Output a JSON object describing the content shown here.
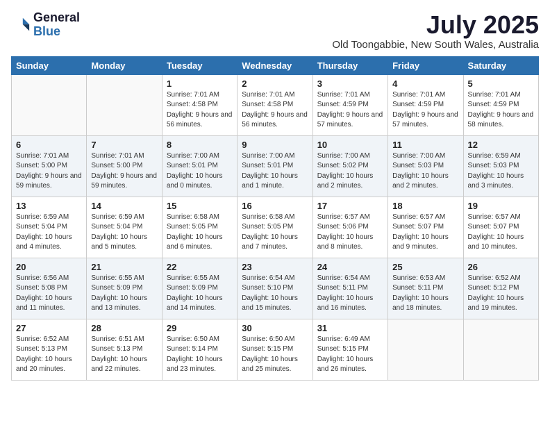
{
  "logo": {
    "general": "General",
    "blue": "Blue"
  },
  "title": {
    "month_year": "July 2025",
    "location": "Old Toongabbie, New South Wales, Australia"
  },
  "weekdays": [
    "Sunday",
    "Monday",
    "Tuesday",
    "Wednesday",
    "Thursday",
    "Friday",
    "Saturday"
  ],
  "weeks": [
    [
      {
        "day": "",
        "info": ""
      },
      {
        "day": "",
        "info": ""
      },
      {
        "day": "1",
        "info": "Sunrise: 7:01 AM\nSunset: 4:58 PM\nDaylight: 9 hours and 56 minutes."
      },
      {
        "day": "2",
        "info": "Sunrise: 7:01 AM\nSunset: 4:58 PM\nDaylight: 9 hours and 56 minutes."
      },
      {
        "day": "3",
        "info": "Sunrise: 7:01 AM\nSunset: 4:59 PM\nDaylight: 9 hours and 57 minutes."
      },
      {
        "day": "4",
        "info": "Sunrise: 7:01 AM\nSunset: 4:59 PM\nDaylight: 9 hours and 57 minutes."
      },
      {
        "day": "5",
        "info": "Sunrise: 7:01 AM\nSunset: 4:59 PM\nDaylight: 9 hours and 58 minutes."
      }
    ],
    [
      {
        "day": "6",
        "info": "Sunrise: 7:01 AM\nSunset: 5:00 PM\nDaylight: 9 hours and 59 minutes."
      },
      {
        "day": "7",
        "info": "Sunrise: 7:01 AM\nSunset: 5:00 PM\nDaylight: 9 hours and 59 minutes."
      },
      {
        "day": "8",
        "info": "Sunrise: 7:00 AM\nSunset: 5:01 PM\nDaylight: 10 hours and 0 minutes."
      },
      {
        "day": "9",
        "info": "Sunrise: 7:00 AM\nSunset: 5:01 PM\nDaylight: 10 hours and 1 minute."
      },
      {
        "day": "10",
        "info": "Sunrise: 7:00 AM\nSunset: 5:02 PM\nDaylight: 10 hours and 2 minutes."
      },
      {
        "day": "11",
        "info": "Sunrise: 7:00 AM\nSunset: 5:03 PM\nDaylight: 10 hours and 2 minutes."
      },
      {
        "day": "12",
        "info": "Sunrise: 6:59 AM\nSunset: 5:03 PM\nDaylight: 10 hours and 3 minutes."
      }
    ],
    [
      {
        "day": "13",
        "info": "Sunrise: 6:59 AM\nSunset: 5:04 PM\nDaylight: 10 hours and 4 minutes."
      },
      {
        "day": "14",
        "info": "Sunrise: 6:59 AM\nSunset: 5:04 PM\nDaylight: 10 hours and 5 minutes."
      },
      {
        "day": "15",
        "info": "Sunrise: 6:58 AM\nSunset: 5:05 PM\nDaylight: 10 hours and 6 minutes."
      },
      {
        "day": "16",
        "info": "Sunrise: 6:58 AM\nSunset: 5:05 PM\nDaylight: 10 hours and 7 minutes."
      },
      {
        "day": "17",
        "info": "Sunrise: 6:57 AM\nSunset: 5:06 PM\nDaylight: 10 hours and 8 minutes."
      },
      {
        "day": "18",
        "info": "Sunrise: 6:57 AM\nSunset: 5:07 PM\nDaylight: 10 hours and 9 minutes."
      },
      {
        "day": "19",
        "info": "Sunrise: 6:57 AM\nSunset: 5:07 PM\nDaylight: 10 hours and 10 minutes."
      }
    ],
    [
      {
        "day": "20",
        "info": "Sunrise: 6:56 AM\nSunset: 5:08 PM\nDaylight: 10 hours and 11 minutes."
      },
      {
        "day": "21",
        "info": "Sunrise: 6:55 AM\nSunset: 5:09 PM\nDaylight: 10 hours and 13 minutes."
      },
      {
        "day": "22",
        "info": "Sunrise: 6:55 AM\nSunset: 5:09 PM\nDaylight: 10 hours and 14 minutes."
      },
      {
        "day": "23",
        "info": "Sunrise: 6:54 AM\nSunset: 5:10 PM\nDaylight: 10 hours and 15 minutes."
      },
      {
        "day": "24",
        "info": "Sunrise: 6:54 AM\nSunset: 5:11 PM\nDaylight: 10 hours and 16 minutes."
      },
      {
        "day": "25",
        "info": "Sunrise: 6:53 AM\nSunset: 5:11 PM\nDaylight: 10 hours and 18 minutes."
      },
      {
        "day": "26",
        "info": "Sunrise: 6:52 AM\nSunset: 5:12 PM\nDaylight: 10 hours and 19 minutes."
      }
    ],
    [
      {
        "day": "27",
        "info": "Sunrise: 6:52 AM\nSunset: 5:13 PM\nDaylight: 10 hours and 20 minutes."
      },
      {
        "day": "28",
        "info": "Sunrise: 6:51 AM\nSunset: 5:13 PM\nDaylight: 10 hours and 22 minutes."
      },
      {
        "day": "29",
        "info": "Sunrise: 6:50 AM\nSunset: 5:14 PM\nDaylight: 10 hours and 23 minutes."
      },
      {
        "day": "30",
        "info": "Sunrise: 6:50 AM\nSunset: 5:15 PM\nDaylight: 10 hours and 25 minutes."
      },
      {
        "day": "31",
        "info": "Sunrise: 6:49 AM\nSunset: 5:15 PM\nDaylight: 10 hours and 26 minutes."
      },
      {
        "day": "",
        "info": ""
      },
      {
        "day": "",
        "info": ""
      }
    ]
  ]
}
